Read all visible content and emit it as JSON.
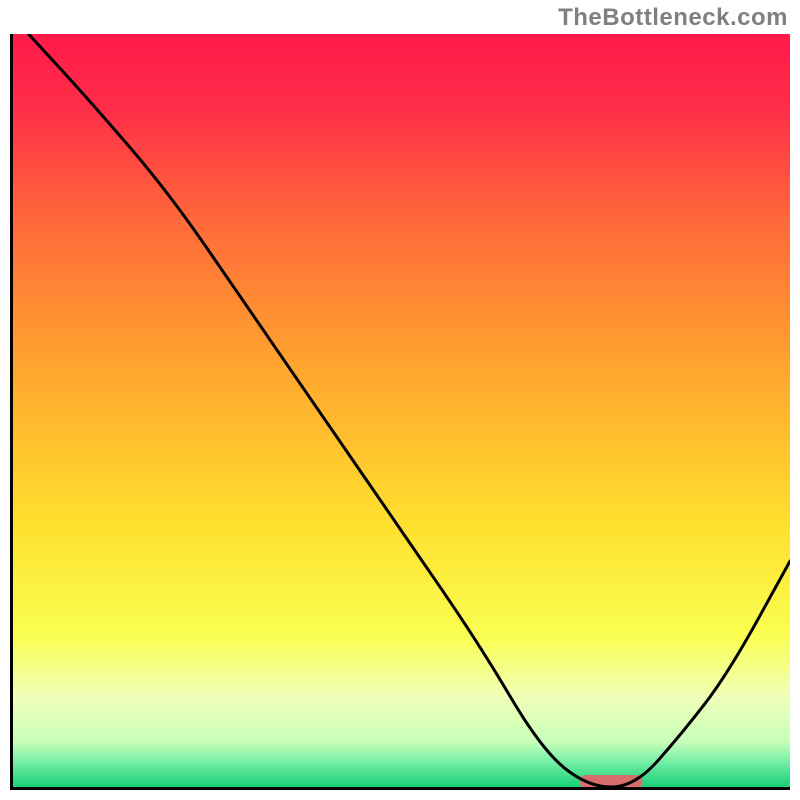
{
  "watermark": {
    "text": "TheBottleneck.com"
  },
  "chart_data": {
    "type": "line",
    "title": "",
    "xlabel": "",
    "ylabel": "",
    "xlim": [
      0,
      100
    ],
    "ylim": [
      0,
      100
    ],
    "series": [
      {
        "name": "curve",
        "x": [
          2,
          10,
          20,
          30,
          40,
          50,
          60,
          68,
          74,
          80,
          86,
          92,
          100
        ],
        "values": [
          100,
          91,
          79,
          64,
          49,
          34,
          19,
          5,
          0,
          0,
          7,
          15,
          30
        ]
      }
    ],
    "marker": {
      "name": "highlight-bar",
      "x_start": 73,
      "x_end": 81,
      "y": 0,
      "color": "#d86d6d"
    },
    "background_gradient": {
      "stops": [
        {
          "offset": 0.0,
          "color": "#ff1a4b"
        },
        {
          "offset": 0.1,
          "color": "#ff2f48"
        },
        {
          "offset": 0.25,
          "color": "#ff6a3a"
        },
        {
          "offset": 0.45,
          "color": "#ffa82e"
        },
        {
          "offset": 0.65,
          "color": "#ffe02e"
        },
        {
          "offset": 0.8,
          "color": "#faff52"
        },
        {
          "offset": 0.88,
          "color": "#f0ffb8"
        },
        {
          "offset": 0.94,
          "color": "#c8ffba"
        },
        {
          "offset": 0.965,
          "color": "#7af0a8"
        },
        {
          "offset": 1.0,
          "color": "#18d078"
        }
      ]
    }
  }
}
